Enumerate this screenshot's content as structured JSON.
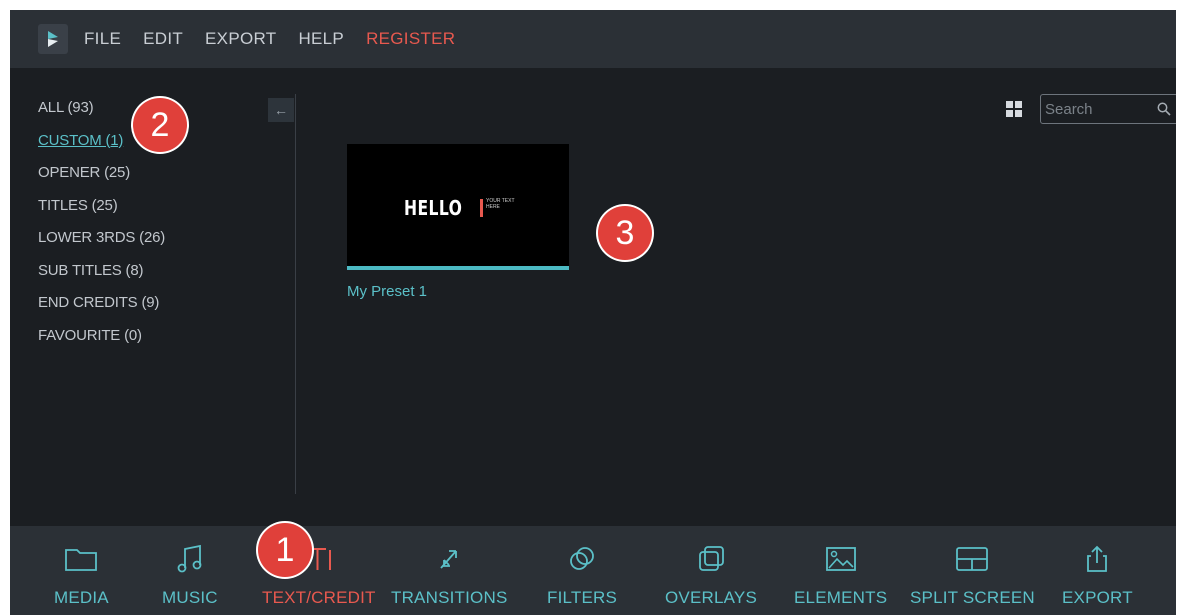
{
  "menu": {
    "items": [
      "FILE",
      "EDIT",
      "EXPORT",
      "HELP"
    ],
    "register_label": "REGISTER"
  },
  "sidebar": {
    "categories": [
      {
        "label": "ALL (93)"
      },
      {
        "label": "CUSTOM (1)"
      },
      {
        "label": "OPENER (25)"
      },
      {
        "label": "TITLES (25)"
      },
      {
        "label": "LOWER 3RDS (26)"
      },
      {
        "label": "SUB TITLES (8)"
      },
      {
        "label": "END CREDITS (9)"
      },
      {
        "label": "FAVOURITE (0)"
      }
    ],
    "active_index": 1,
    "collapse_arrow": "←"
  },
  "search": {
    "placeholder": "Search"
  },
  "preset": {
    "label": "My Preset 1",
    "thumb_title": "HELLO",
    "thumb_subtitle": "YOUR TEXT HERE"
  },
  "toolbar": {
    "items": [
      {
        "label": "MEDIA",
        "icon": "folder-icon"
      },
      {
        "label": "MUSIC",
        "icon": "music-note-icon"
      },
      {
        "label": "TEXT/CREDIT",
        "icon": "text-icon"
      },
      {
        "label": "TRANSITIONS",
        "icon": "transitions-icon"
      },
      {
        "label": "FILTERS",
        "icon": "filters-icon"
      },
      {
        "label": "OVERLAYS",
        "icon": "overlays-icon"
      },
      {
        "label": "ELEMENTS",
        "icon": "elements-icon"
      },
      {
        "label": "SPLIT SCREEN",
        "icon": "split-screen-icon"
      },
      {
        "label": "EXPORT",
        "icon": "export-icon"
      }
    ],
    "active_index": 2
  },
  "annotations": [
    "1",
    "2",
    "3"
  ],
  "colors": {
    "accent": "#5bc0c8",
    "active": "#e8594f",
    "badge": "#e0403a",
    "bar_bg": "#2b3036",
    "panel_bg": "#1b1e22"
  }
}
